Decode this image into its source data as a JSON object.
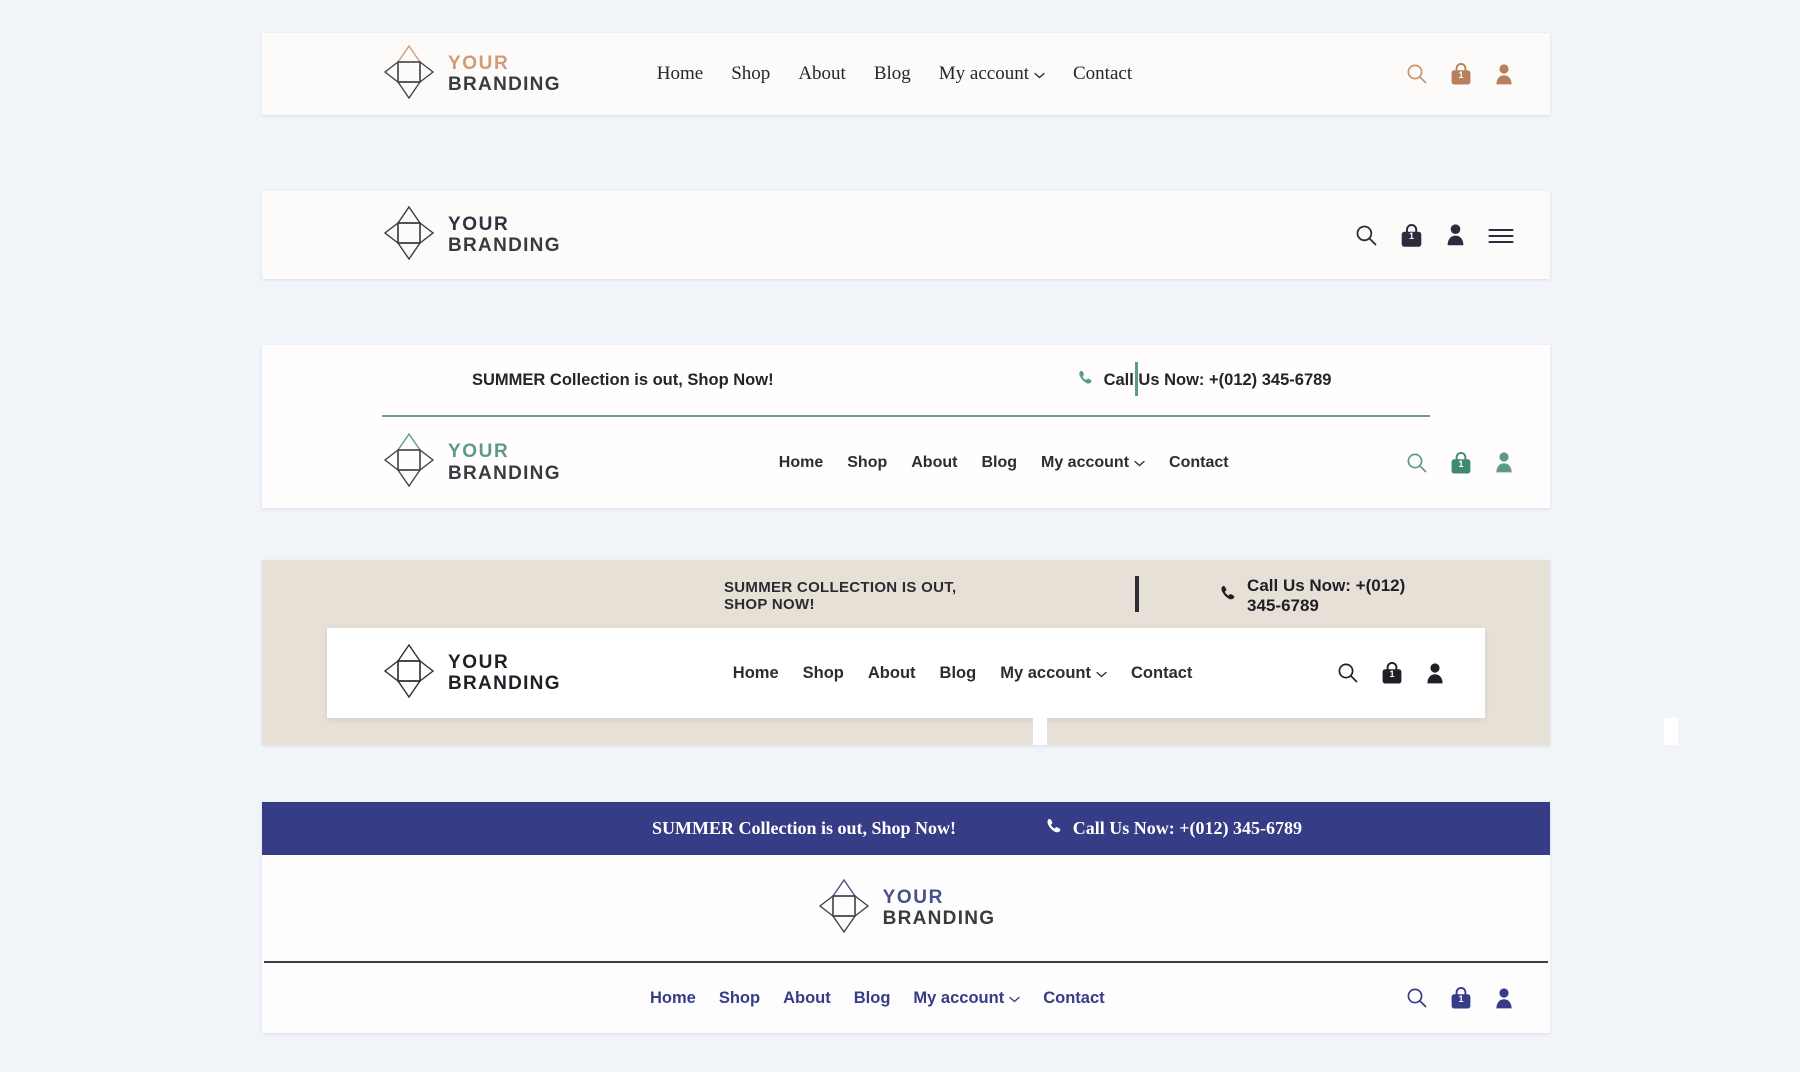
{
  "background_color": "#f1f4f9",
  "brand": {
    "line1": "YOUR",
    "line2": "BRANDING",
    "mark": "diamond-logo-icon"
  },
  "promo": {
    "title_case": "SUMMER Collection is out, Shop Now!",
    "upper_case": "SUMMER COLLECTION IS OUT, SHOP NOW!",
    "call_label": "Call Us Now: +(012) 345-6789",
    "phone_icon": "phone-icon"
  },
  "cart": {
    "count": "1"
  },
  "headers": [
    {
      "id": "header-1",
      "accent": "#d29a77",
      "nav": [
        {
          "label": "Home",
          "dropdown": false
        },
        {
          "label": "Shop",
          "dropdown": false
        },
        {
          "label": "About",
          "dropdown": false
        },
        {
          "label": "Blog",
          "dropdown": false
        },
        {
          "label": "My account",
          "dropdown": true
        },
        {
          "label": "Contact",
          "dropdown": false
        }
      ],
      "icons": [
        "search-icon",
        "shopping-bag-icon",
        "user-account-icon"
      ]
    },
    {
      "id": "header-2",
      "accent": "#2f3040",
      "nav": [],
      "icons": [
        "search-icon",
        "shopping-bag-icon",
        "user-account-icon",
        "hamburger-menu-icon"
      ]
    },
    {
      "id": "header-3",
      "accent": "#5e9b86",
      "nav": [
        {
          "label": "Home",
          "dropdown": false
        },
        {
          "label": "Shop",
          "dropdown": false
        },
        {
          "label": "About",
          "dropdown": false
        },
        {
          "label": "Blog",
          "dropdown": false
        },
        {
          "label": "My account",
          "dropdown": true
        },
        {
          "label": "Contact",
          "dropdown": false
        }
      ],
      "icons": [
        "search-icon",
        "shopping-bag-icon",
        "user-account-icon"
      ]
    },
    {
      "id": "header-4",
      "accent": "#1f1f26",
      "bar_background": "#e7e0d7",
      "nav": [
        {
          "label": "Home",
          "dropdown": false
        },
        {
          "label": "Shop",
          "dropdown": false
        },
        {
          "label": "About",
          "dropdown": false
        },
        {
          "label": "Blog",
          "dropdown": false
        },
        {
          "label": "My account",
          "dropdown": true
        },
        {
          "label": "Contact",
          "dropdown": false
        }
      ],
      "icons": [
        "search-icon",
        "shopping-bag-icon",
        "user-account-icon"
      ]
    },
    {
      "id": "header-5",
      "accent": "#363c86",
      "bar_background": "#363c86",
      "nav": [
        {
          "label": "Home",
          "dropdown": false
        },
        {
          "label": "Shop",
          "dropdown": false
        },
        {
          "label": "About",
          "dropdown": false
        },
        {
          "label": "Blog",
          "dropdown": false
        },
        {
          "label": "My account",
          "dropdown": true
        },
        {
          "label": "Contact",
          "dropdown": false
        }
      ],
      "icons": [
        "search-icon",
        "shopping-bag-icon",
        "user-account-icon"
      ]
    }
  ],
  "glyphs": {
    "caret_down": "⌄"
  }
}
